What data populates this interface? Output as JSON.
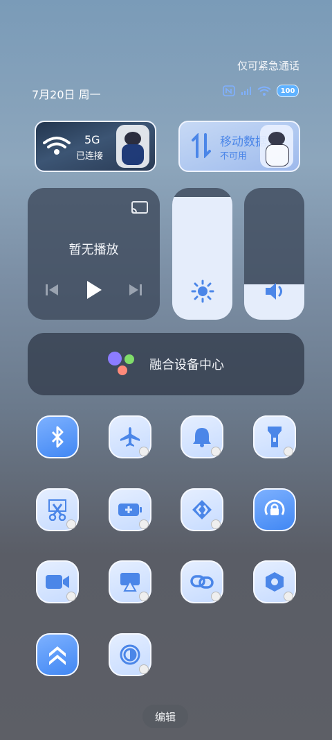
{
  "status_bar": {
    "emergency_text": "仅可紧急通话",
    "date": "7月20日 周一",
    "battery": "100",
    "icons": [
      "nfc-icon",
      "signal-icon",
      "wifi-icon",
      "battery-icon"
    ]
  },
  "wifi_tile": {
    "title": "5G",
    "subtitle": "已连接",
    "icon": "wifi-icon"
  },
  "data_tile": {
    "title": "移动数据",
    "subtitle": "不可用",
    "icon": "data-transfer-icon"
  },
  "media": {
    "title": "暂无播放",
    "icons": [
      "cast-icon",
      "previous-icon",
      "play-icon",
      "next-icon"
    ]
  },
  "brightness": {
    "level": 0.93,
    "icon": "sun-icon"
  },
  "volume": {
    "level": 0.27,
    "icon": "speaker-icon"
  },
  "fusion": {
    "label": "融合设备中心"
  },
  "toggles": [
    {
      "name": "bluetooth",
      "on": true,
      "icon": "bluetooth-icon"
    },
    {
      "name": "airplane-mode",
      "on": false,
      "icon": "airplane-icon"
    },
    {
      "name": "sound",
      "on": false,
      "icon": "bell-icon"
    },
    {
      "name": "flashlight",
      "on": false,
      "icon": "flashlight-icon"
    },
    {
      "name": "screenshot",
      "on": false,
      "icon": "scissors-icon"
    },
    {
      "name": "battery-saver",
      "on": false,
      "icon": "battery-plus-icon"
    },
    {
      "name": "cast",
      "on": false,
      "icon": "cast-arrows-icon"
    },
    {
      "name": "rotation-lock",
      "on": true,
      "icon": "rotate-lock-icon"
    },
    {
      "name": "screen-record",
      "on": false,
      "icon": "video-icon"
    },
    {
      "name": "screen-mirror",
      "on": false,
      "icon": "airplay-icon"
    },
    {
      "name": "link",
      "on": false,
      "icon": "link-icon"
    },
    {
      "name": "settings",
      "on": false,
      "icon": "hexagon-icon"
    },
    {
      "name": "performance",
      "on": true,
      "icon": "double-chevron-up-icon"
    },
    {
      "name": "dark-mode",
      "on": false,
      "icon": "contrast-icon"
    }
  ],
  "edit_button": {
    "label": "编辑"
  },
  "colors": {
    "accent": "#4b86e8",
    "toggle_on": "#3f86f3",
    "toggle_off": "#dbe8ff"
  }
}
